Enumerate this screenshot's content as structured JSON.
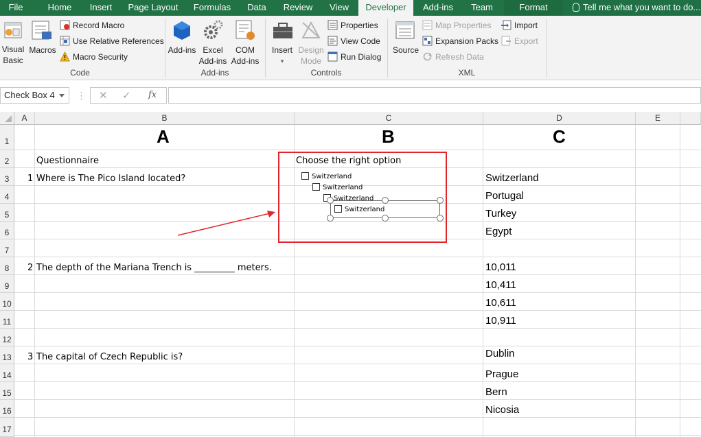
{
  "ribbon_tabs": [
    "File",
    "Home",
    "Insert",
    "Page Layout",
    "Formulas",
    "Data",
    "Review",
    "View",
    "Developer",
    "Add-ins",
    "Team",
    "Format"
  ],
  "active_tab": "Developer",
  "tell_me": "Tell me what you want to do...",
  "groups": {
    "code": {
      "label": "Code",
      "visual_basic": "Visual Basic",
      "macros": "Macros",
      "record_macro": "Record Macro",
      "use_relative_references": "Use Relative References",
      "macro_security": "Macro Security"
    },
    "addins": {
      "label": "Add-ins",
      "addins": "Add-ins",
      "excel_addins": "Excel Add-ins",
      "com_addins": "COM Add-ins"
    },
    "controls": {
      "label": "Controls",
      "insert": "Insert",
      "design_mode": "Design Mode",
      "properties": "Properties",
      "view_code": "View Code",
      "run_dialog": "Run Dialog"
    },
    "xml": {
      "label": "XML",
      "source": "Source",
      "map_properties": "Map Properties",
      "expansion_packs": "Expansion Packs",
      "refresh_data": "Refresh Data",
      "import": "Import",
      "export": "Export"
    }
  },
  "formula_bar": {
    "name_box": "Check Box 4",
    "dots": "⋮",
    "cancel": "✕",
    "enter": "✓",
    "fx": "fx",
    "formula": ""
  },
  "columns": [
    "A",
    "B",
    "C",
    "D",
    "E"
  ],
  "rows": [
    "1",
    "2",
    "3",
    "4",
    "5",
    "6",
    "7",
    "8",
    "9",
    "10",
    "11",
    "12",
    "13",
    "14",
    "15",
    "16",
    "17"
  ],
  "cells": {
    "B1": "A",
    "C1": "B",
    "D1": "C",
    "B2": "Questionnaire",
    "C2": "Choose the right option",
    "A3": "1",
    "B3": "Where is The Pico Island located?",
    "D3": "Switzerland",
    "D4": "Portugal",
    "D5": "Turkey",
    "D6": "Egypt",
    "A8": "2",
    "B8": "The depth of the Mariana Trench is _________ meters.",
    "D8": "10,011",
    "D9": "10,411",
    "D10": "10,611",
    "D11": "10,911",
    "A13": "3",
    "B13": "The capital of Czech Republic is?",
    "D13": "Dublin",
    "D14": "Prague",
    "D15": "Bern",
    "D16": "Nicosia"
  },
  "checkboxes": [
    "Switzerland",
    "Switzerland",
    "Switzerland",
    "Switzerland"
  ],
  "colors": {
    "excel_green": "#217346",
    "highlight_red": "#e0262c"
  }
}
